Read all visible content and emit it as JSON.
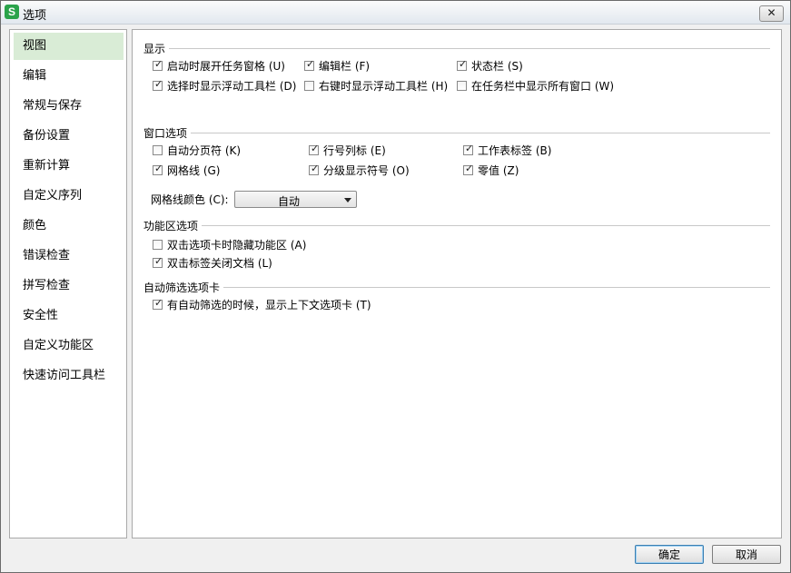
{
  "window": {
    "title": "选项",
    "app_icon_letter": "S",
    "close_symbol": "✕",
    "brand_color": "#2aa34a"
  },
  "sidebar": {
    "items": [
      {
        "label": "视图",
        "selected": true
      },
      {
        "label": "编辑"
      },
      {
        "label": "常规与保存"
      },
      {
        "label": "备份设置"
      },
      {
        "label": "重新计算"
      },
      {
        "label": "自定义序列"
      },
      {
        "label": "颜色"
      },
      {
        "label": "错误检查"
      },
      {
        "label": "拼写检查"
      },
      {
        "label": "安全性"
      },
      {
        "label": "自定义功能区"
      },
      {
        "label": "快速访问工具栏"
      }
    ]
  },
  "display": {
    "title": "显示",
    "options": [
      {
        "label": "启动时展开任务窗格 (U)",
        "checked": true
      },
      {
        "label": "编辑栏 (F)",
        "checked": true
      },
      {
        "label": "状态栏 (S)",
        "checked": true
      },
      {
        "label": "选择时显示浮动工具栏 (D)",
        "checked": true
      },
      {
        "label": "右键时显示浮动工具栏 (H)",
        "checked": false
      },
      {
        "label": "在任务栏中显示所有窗口 (W)",
        "checked": false
      }
    ]
  },
  "window_options": {
    "title": "窗口选项",
    "options": [
      {
        "label": "自动分页符 (K)",
        "checked": false
      },
      {
        "label": "行号列标 (E)",
        "checked": true
      },
      {
        "label": "工作表标签 (B)",
        "checked": true
      },
      {
        "label": "网格线 (G)",
        "checked": true
      },
      {
        "label": "分级显示符号 (O)",
        "checked": true
      },
      {
        "label": "零值 (Z)",
        "checked": true
      }
    ],
    "grid_color_label": "网格线颜色 (C):",
    "grid_color_value": "自动"
  },
  "ribbon": {
    "title": "功能区选项",
    "options": [
      {
        "label": "双击选项卡时隐藏功能区 (A)",
        "checked": false
      },
      {
        "label": "双击标签关闭文档 (L)",
        "checked": true
      }
    ]
  },
  "autofilter": {
    "title": "自动筛选选项卡",
    "options": [
      {
        "label": "有自动筛选的时候，显示上下文选项卡 (T)",
        "checked": true
      }
    ]
  },
  "buttons": {
    "ok": "确定",
    "cancel": "取消"
  },
  "check_mark": "✓"
}
